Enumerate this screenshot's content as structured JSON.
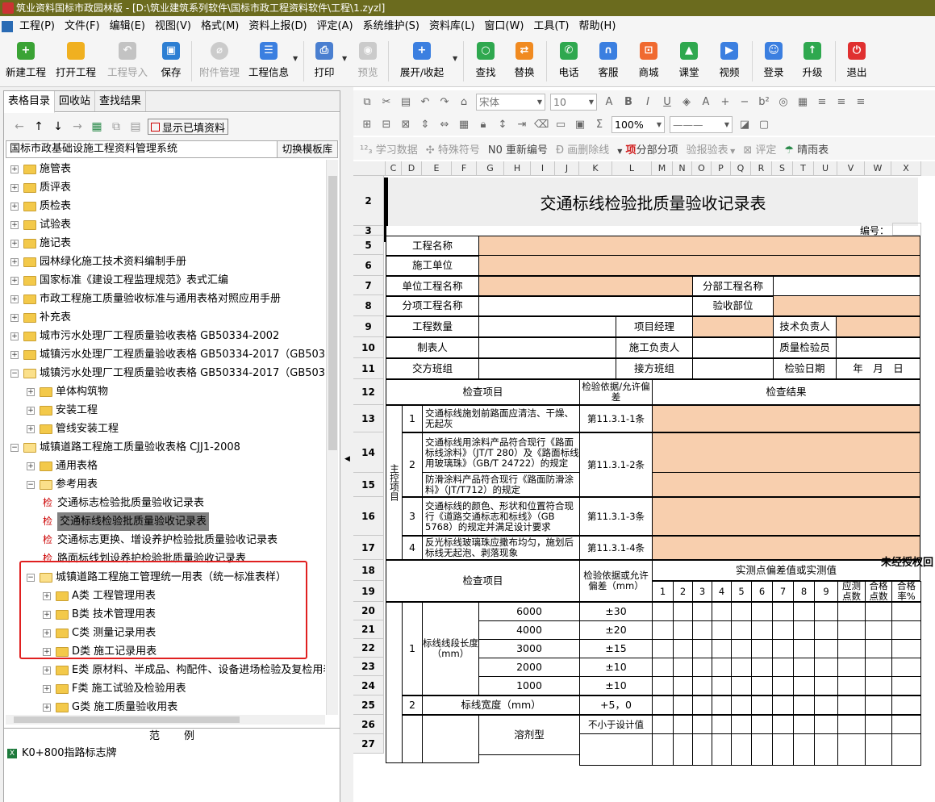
{
  "window": {
    "title": "筑业资料国标市政园林版 - [D:\\筑业建筑系列软件\\国标市政工程资料软件\\工程\\1.zyzl]"
  },
  "menu": [
    "工程(P)",
    "文件(F)",
    "编辑(E)",
    "视图(V)",
    "格式(M)",
    "资料上报(D)",
    "评定(A)",
    "系统维护(S)",
    "资料库(L)",
    "窗口(W)",
    "工具(T)",
    "帮助(H)"
  ],
  "toolbar": {
    "new_project": "新建工程",
    "open_project": "打开工程",
    "import_project": "工程导入",
    "save": "保存",
    "attachments": "附件管理",
    "project_info": "工程信息",
    "print": "打印",
    "preview": "预览",
    "expand_collapse": "展开/收起",
    "search": "查找",
    "replace": "替换",
    "phone": "电话",
    "service": "客服",
    "mall": "商城",
    "classroom": "课堂",
    "video": "视频",
    "login": "登录",
    "upgrade": "升级",
    "exit": "退出"
  },
  "left_tabs": [
    "表格目录",
    "回收站",
    "查找结果"
  ],
  "tree_tools": {
    "show_filled": "显示已填资料"
  },
  "system_row": {
    "name": "国标市政基础设施工程资料管理系统",
    "switch_template": "切换模板库"
  },
  "tree": [
    {
      "label": "施管表",
      "level": 0,
      "state": "collapsed"
    },
    {
      "label": "质评表",
      "level": 0,
      "state": "collapsed"
    },
    {
      "label": "质检表",
      "level": 0,
      "state": "collapsed"
    },
    {
      "label": "试验表",
      "level": 0,
      "state": "collapsed"
    },
    {
      "label": "施记表",
      "level": 0,
      "state": "collapsed"
    },
    {
      "label": "园林绿化施工技术资料编制手册",
      "level": 0,
      "state": "collapsed"
    },
    {
      "label": "国家标准《建设工程监理规范》表式汇编",
      "level": 0,
      "state": "collapsed"
    },
    {
      "label": "市政工程施工质量验收标准与通用表格对照应用手册",
      "level": 0,
      "state": "collapsed"
    },
    {
      "label": "补充表",
      "level": 0,
      "state": "collapsed"
    },
    {
      "label": "城市污水处理厂工程质量验收表格 GB50334-2002",
      "level": 0,
      "state": "collapsed"
    },
    {
      "label": "城镇污水处理厂工程质量验收表格 GB50334-2017（GB503",
      "level": 0,
      "state": "collapsed"
    },
    {
      "label": "城镇污水处理厂工程质量验收表格 GB50334-2017（GB503",
      "level": 0,
      "state": "expanded"
    },
    {
      "label": "单体构筑物",
      "level": 1,
      "state": "collapsed"
    },
    {
      "label": "安装工程",
      "level": 1,
      "state": "collapsed"
    },
    {
      "label": "管线安装工程",
      "level": 1,
      "state": "collapsed"
    },
    {
      "label": "城镇道路工程施工质量验收表格 CJJ1-2008",
      "level": 0,
      "state": "expanded"
    },
    {
      "label": "通用表格",
      "level": 1,
      "state": "collapsed"
    },
    {
      "label": "参考用表",
      "level": 1,
      "state": "expanded"
    },
    {
      "label": "交通标志检验批质量验收记录表",
      "level": 2,
      "state": "doc"
    },
    {
      "label": "交通标线检验批质量验收记录表",
      "level": 2,
      "state": "doc",
      "selected": true
    },
    {
      "label": "交通标志更换、增设养护检验批质量验收记录表",
      "level": 2,
      "state": "doc"
    },
    {
      "label": "路面标线划设养护检验批质量验收记录表",
      "level": 2,
      "state": "doc"
    },
    {
      "label": "城镇道路工程施工管理统一用表（统一标准表样）",
      "level": 1,
      "state": "expanded"
    },
    {
      "label": "A类 工程管理用表",
      "level": 2,
      "state": "collapsed"
    },
    {
      "label": "B类 技术管理用表",
      "level": 2,
      "state": "collapsed"
    },
    {
      "label": "C类 测量记录用表",
      "level": 2,
      "state": "collapsed"
    },
    {
      "label": "D类 施工记录用表",
      "level": 2,
      "state": "collapsed"
    },
    {
      "label": "E类 原材料、半成品、构配件、设备进场检验及复检用表",
      "level": 2,
      "state": "collapsed"
    },
    {
      "label": "F类 施工试验及检验用表",
      "level": 2,
      "state": "collapsed"
    },
    {
      "label": "G类 施工质量验收用表",
      "level": 2,
      "state": "collapsed"
    }
  ],
  "examples": {
    "header": "范例",
    "items": [
      "K0+800指路标志牌"
    ]
  },
  "format_toolbar": {
    "font": "宋体",
    "size": "10",
    "zoom": "100%",
    "study_data": "学习数据",
    "special_symbol": "特殊符号",
    "renumber": "重新编号",
    "strikeline": "画删除线",
    "sub_items": "分部分项",
    "report_check": "报验表",
    "evaluate": "评定",
    "weather": "晴雨表"
  },
  "sheet": {
    "columns": [
      "C",
      "D",
      "E",
      "F",
      "G",
      "H",
      "I",
      "J",
      "K",
      "L",
      "M",
      "N",
      "O",
      "P",
      "Q",
      "R",
      "S",
      "T",
      "U",
      "V",
      "W",
      "X"
    ],
    "rows": [
      "2",
      "3",
      "5",
      "6",
      "7",
      "8",
      "9",
      "10",
      "11",
      "12",
      "13",
      "14",
      "15",
      "16",
      "17",
      "18",
      "19",
      "20",
      "21",
      "22",
      "23",
      "24",
      "25",
      "26",
      "27"
    ],
    "title": "交通标线检验批质量验收记录表",
    "serial_label": "编号：",
    "project_name": "工程名称",
    "construction_unit": "施工单位",
    "unit_project": "单位工程名称",
    "division_project": "分部工程名称",
    "sub_project": "分项工程名称",
    "acceptance_part": "验收部位",
    "quantity": "工程数量",
    "project_manager": "项目经理",
    "technical_lead": "技术负责人",
    "preparer": "制表人",
    "construction_lead": "施工负责人",
    "quality_inspector": "质量检验员",
    "handover_shift": "交方班组",
    "receiving_shift": "接方班组",
    "inspection_date": "检验日期",
    "date_value": "年　月　日",
    "check_item": "检查项目",
    "basis": "检验依据/允许偏差",
    "result": "检查结果",
    "main_control": "主控项目",
    "items": [
      {
        "no": "1",
        "text": "交通标线施划前路面应清洁、干燥、无起灰",
        "basis": "第11.3.1-1条"
      },
      {
        "no": "2",
        "text": "交通标线用涂料产品符合现行《路面标线涂料》（JT/T 280）及《路面标线用玻璃珠》（GB/T 24722）的规定",
        "text_b": "防滑涂料产品符合现行《路面防滑涂料》（JT/T712）的规定",
        "basis": "第11.3.1-2条"
      },
      {
        "no": "3",
        "text": "交通标线的颜色、形状和位置符合现行《道路交通标志和标线》（GB 5768）的规定并满足设计要求",
        "basis": "第11.3.1-3条"
      },
      {
        "no": "4",
        "text": "反光标线玻璃珠应撒布均匀，施划后标线无起泡、剥落现象",
        "basis": "第11.3.1-4条"
      }
    ],
    "measured_header": "实测点偏差值或实测值",
    "basis_tolerance": "检验依据或允许偏差（mm）",
    "point_numbers": [
      "1",
      "2",
      "3",
      "4",
      "5",
      "6",
      "7",
      "8",
      "9"
    ],
    "should_points": "应测点数",
    "pass_points": "合格点数",
    "pass_rate": "合格率%",
    "segment_length_label": "标线线段长度（mm）",
    "segment_no": "1",
    "segments": [
      {
        "length": "6000",
        "tol": "±30"
      },
      {
        "length": "4000",
        "tol": "±20"
      },
      {
        "length": "3000",
        "tol": "±15"
      },
      {
        "length": "2000",
        "tol": "±10"
      },
      {
        "length": "1000",
        "tol": "±10"
      }
    ],
    "width_no": "2",
    "width_label": "标线宽度（mm）",
    "width_tol": "+5，0",
    "solvent_label": "溶剂型",
    "solvent_tol": "不小于设计值",
    "watermark": "未经授权回"
  },
  "colors": {
    "titlebar": "#6b6b1e",
    "fill_orange": "#f8cfae",
    "selection_gray": "#808080",
    "highlight_red": "#e02020"
  }
}
